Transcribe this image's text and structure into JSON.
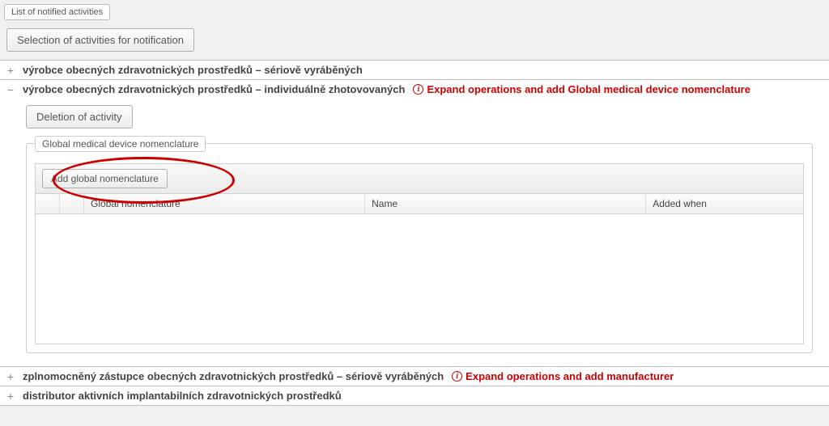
{
  "tabs": {
    "listNotified": "List of notified activities"
  },
  "toolbar": {
    "selectionBtn": "Selection of activities for notification"
  },
  "accordion": {
    "row1": {
      "label": "výrobce obecných zdravotnických prostředků – sériově vyráběných"
    },
    "row2": {
      "label": "výrobce obecných zdravotnických prostředků – individuálně zhotovovaných",
      "warnIcon": "i",
      "warnText": "Expand operations and add Global medical device nomenclature"
    },
    "row3": {
      "label": "zplnomocněný zástupce obecných zdravotnických prostředků – sériově vyráběných",
      "warnIcon": "i",
      "warnText": "Expand operations and add manufacturer"
    },
    "row4": {
      "label": "distributor aktivních implantabilních zdravotnických prostředků"
    }
  },
  "panel": {
    "deleteBtn": "Deletion of activity",
    "fieldsetTitle": "Global medical device nomenclature",
    "addBtn": "Add global nomenclature",
    "columns": {
      "globalNom": "Global nomenclature",
      "name": "Name",
      "addedWhen": "Added when"
    }
  }
}
